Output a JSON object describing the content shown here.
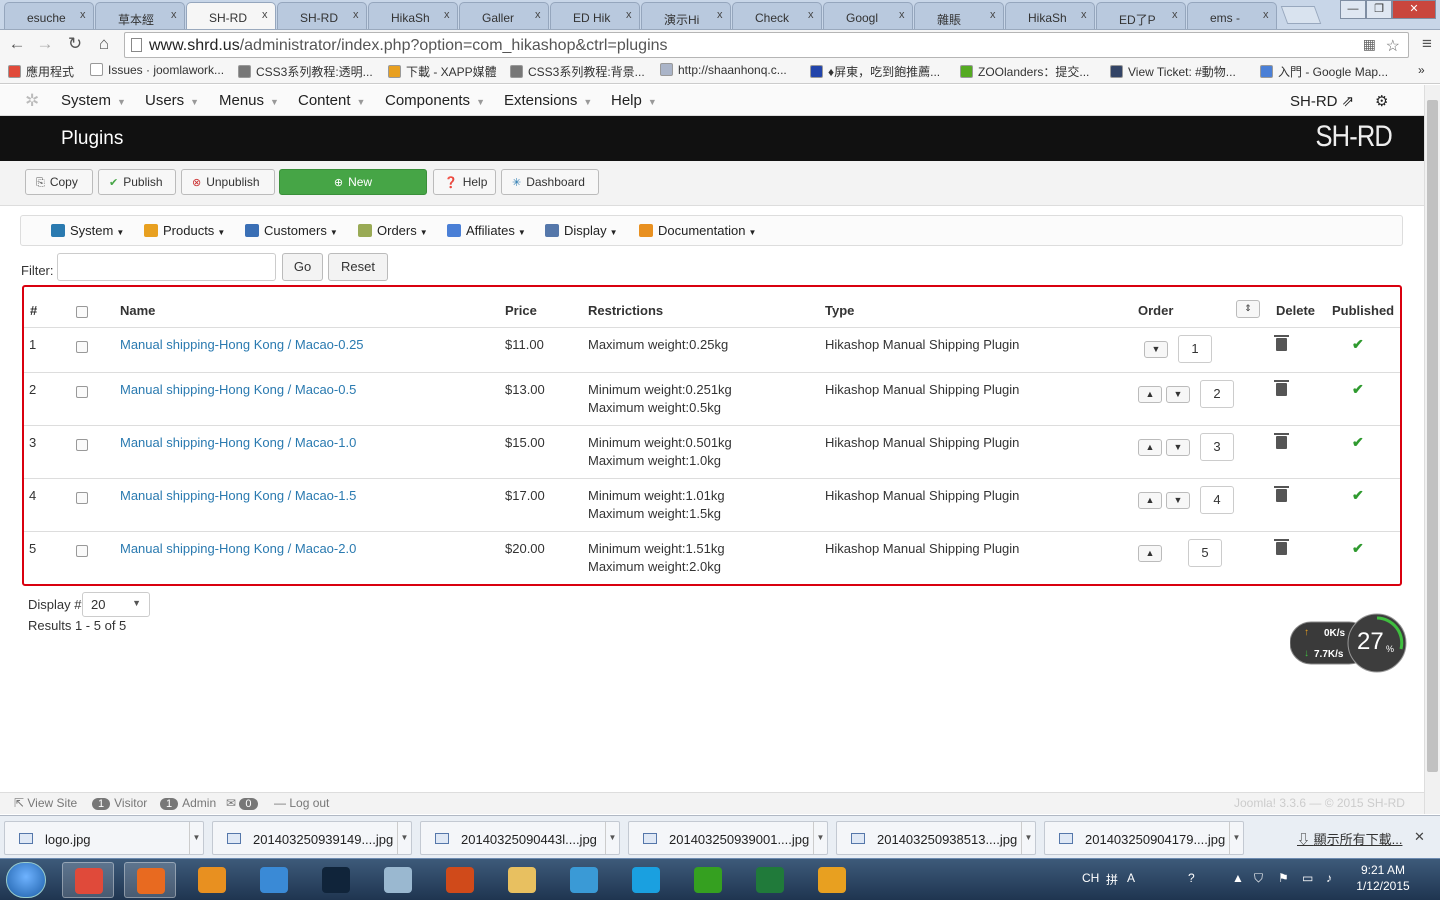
{
  "browser": {
    "tabs": [
      {
        "label": "esuche",
        "color": "#d35400"
      },
      {
        "label": "草本經",
        "color": "#d35400"
      },
      {
        "label": "SH-RD",
        "color": "#d35400",
        "active": true
      },
      {
        "label": "SH-RD",
        "color": "#d35400"
      },
      {
        "label": "HikaSh",
        "color": "#5aa0c8"
      },
      {
        "label": "Galler",
        "color": "#555555"
      },
      {
        "label": "ED Hik",
        "color": "#d35400"
      },
      {
        "label": "演示Hi",
        "color": "#d35400"
      },
      {
        "label": "Check",
        "color": "#333333"
      },
      {
        "label": "Googl",
        "color": "#4a7fd6"
      },
      {
        "label": "雜賬",
        "color": "#5aaa4a"
      },
      {
        "label": "HikaSh",
        "color": "#5aa0c8"
      },
      {
        "label": "ED了P",
        "color": "#d35400"
      },
      {
        "label": "ems -",
        "color": "#4a7fd6"
      }
    ],
    "tab_close": "x",
    "window_controls": {
      "minimize": "—",
      "restore": "❐",
      "close": "✕"
    },
    "url_host": "www.shrd.us",
    "url_path": "/administrator/index.php?option=com_hikashop&ctrl=plugins",
    "bookmarks": [
      {
        "label": "應用程式",
        "color": "#e04a3a"
      },
      {
        "label": "Issues · joomlawork...",
        "color": "#ffffff"
      },
      {
        "label": "CSS3系列教程:透明...",
        "color": "#777777"
      },
      {
        "label": "下載 - XAPP媒體",
        "color": "#e8a020"
      },
      {
        "label": "CSS3系列教程:背景...",
        "color": "#777777"
      },
      {
        "label": "http://shaanhonq.c...",
        "color": "#aab4c8"
      },
      {
        "label": "♦屏東，吃到飽推薦...",
        "color": "#2244aa"
      },
      {
        "label": "ZOOlanders：提交...",
        "color": "#55aa22"
      },
      {
        "label": "View Ticket: #動物...",
        "color": "#334466"
      },
      {
        "label": "入門 - Google Map...",
        "color": "#4a7fd6"
      }
    ],
    "bookmarks_more": "»"
  },
  "joomla": {
    "menu": [
      "System",
      "Users",
      "Menus",
      "Content",
      "Components",
      "Extensions",
      "Help"
    ],
    "site_link": "SH-RD",
    "page_title": "Plugins",
    "brand": "SH-RD",
    "toolbar": [
      {
        "label": "Copy",
        "icon": "copy-icon"
      },
      {
        "label": "Publish",
        "icon": "check-icon"
      },
      {
        "label": "Unpublish",
        "icon": "cancel-icon"
      },
      {
        "label": "New",
        "icon": "plus-icon"
      },
      {
        "label": "Help",
        "icon": "question-icon"
      },
      {
        "label": "Dashboard",
        "icon": "dashboard-icon"
      }
    ]
  },
  "hikashop_menu": [
    {
      "label": "System",
      "color": "#2a7ab0"
    },
    {
      "label": "Products",
      "color": "#e8a020"
    },
    {
      "label": "Customers",
      "color": "#3a6fb5"
    },
    {
      "label": "Orders",
      "color": "#99aa55"
    },
    {
      "label": "Affiliates",
      "color": "#4a7fd6"
    },
    {
      "label": "Display",
      "color": "#5577aa"
    },
    {
      "label": "Documentation",
      "color": "#e89020"
    }
  ],
  "filter": {
    "label": "Filter:",
    "value": "",
    "go": "Go",
    "reset": "Reset"
  },
  "table": {
    "headers": {
      "num": "#",
      "name": "Name",
      "price": "Price",
      "restrictions": "Restrictions",
      "type": "Type",
      "order": "Order",
      "delete": "Delete",
      "published": "Published"
    },
    "rows": [
      {
        "num": "1",
        "name": "Manual shipping-Hong Kong / Macao-0.25",
        "price": "$11.00",
        "restrictions": [
          "Maximum weight:0.25kg"
        ],
        "type": "Hikashop Manual Shipping Plugin",
        "order": "1",
        "up": false,
        "down": true
      },
      {
        "num": "2",
        "name": "Manual shipping-Hong Kong / Macao-0.5",
        "price": "$13.00",
        "restrictions": [
          "Minimum weight:0.251kg",
          "Maximum weight:0.5kg"
        ],
        "type": "Hikashop Manual Shipping Plugin",
        "order": "2",
        "up": true,
        "down": true
      },
      {
        "num": "3",
        "name": "Manual shipping-Hong Kong / Macao-1.0",
        "price": "$15.00",
        "restrictions": [
          "Minimum weight:0.501kg",
          "Maximum weight:1.0kg"
        ],
        "type": "Hikashop Manual Shipping Plugin",
        "order": "3",
        "up": true,
        "down": true
      },
      {
        "num": "4",
        "name": "Manual shipping-Hong Kong / Macao-1.5",
        "price": "$17.00",
        "restrictions": [
          "Minimum weight:1.01kg",
          "Maximum weight:1.5kg"
        ],
        "type": "Hikashop Manual Shipping Plugin",
        "order": "4",
        "up": true,
        "down": true
      },
      {
        "num": "5",
        "name": "Manual shipping-Hong Kong / Macao-2.0",
        "price": "$20.00",
        "restrictions": [
          "Minimum weight:1.51kg",
          "Maximum weight:2.0kg"
        ],
        "type": "Hikashop Manual Shipping Plugin",
        "order": "5",
        "up": true,
        "down": false
      }
    ]
  },
  "pagination": {
    "display_label": "Display #",
    "display_value": "20",
    "results": "Results 1 - 5 of 5"
  },
  "speed_widget": {
    "up": "0K/s",
    "down": "7.7K/s",
    "percent": "27",
    "percent_sign": "%"
  },
  "status_bar": {
    "view_site": "View Site",
    "visitor_count": "1",
    "visitor_label": "Visitor",
    "admin_count": "1",
    "admin_label": "Admin",
    "messages_count": "0",
    "logout": "Log out",
    "version": "Joomla! 3.3.6 — © 2015 SH-RD"
  },
  "downloads": {
    "items": [
      "logo.jpg",
      "201403250939149....jpg",
      "20140325090443l....jpg",
      "201403250939001....jpg",
      "201403250938513....jpg",
      "201403250904179....jpg"
    ],
    "show_all": "顯示所有下載...",
    "close": "✕"
  },
  "taskbar": {
    "apps": [
      {
        "name": "chrome",
        "color": "#e04a3a"
      },
      {
        "name": "firefox",
        "color": "#e86a20"
      },
      {
        "name": "media",
        "color": "#e89020"
      },
      {
        "name": "ie",
        "color": "#3a8ad6"
      },
      {
        "name": "photoshop",
        "color": "#10243a"
      },
      {
        "name": "notepad",
        "color": "#9ab8d0"
      },
      {
        "name": "powerpoint",
        "color": "#d04a1a"
      },
      {
        "name": "explorer",
        "color": "#e8c060"
      },
      {
        "name": "skype-qq",
        "color": "#3a9ad6"
      },
      {
        "name": "skype",
        "color": "#1aa0e0"
      },
      {
        "name": "dreamweaver",
        "color": "#35a020"
      },
      {
        "name": "excel",
        "color": "#207a3a"
      },
      {
        "name": "outlook",
        "color": "#e8a020"
      }
    ],
    "tray_text": "CH",
    "time": "9:21 AM",
    "date": "1/12/2015"
  }
}
